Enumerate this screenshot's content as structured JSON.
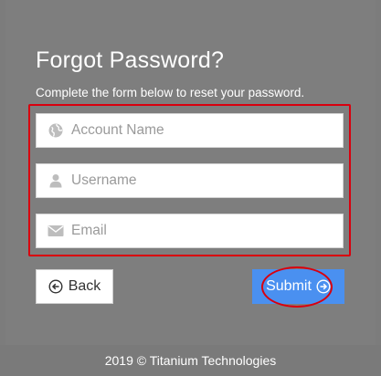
{
  "form": {
    "title": "Forgot Password?",
    "subtitle": "Complete the form below to reset your password.",
    "fields": [
      {
        "placeholder": "Account Name",
        "icon": "globe-icon",
        "value": ""
      },
      {
        "placeholder": "Username",
        "icon": "user-icon",
        "value": ""
      },
      {
        "placeholder": "Email",
        "icon": "envelope-icon",
        "value": ""
      }
    ],
    "back_label": "Back",
    "submit_label": "Submit"
  },
  "footer": {
    "text": "2019 © Titanium Technologies"
  },
  "colors": {
    "background": "#7e7e7e",
    "submit": "#4a90f0",
    "annotation": "#d9000e"
  }
}
